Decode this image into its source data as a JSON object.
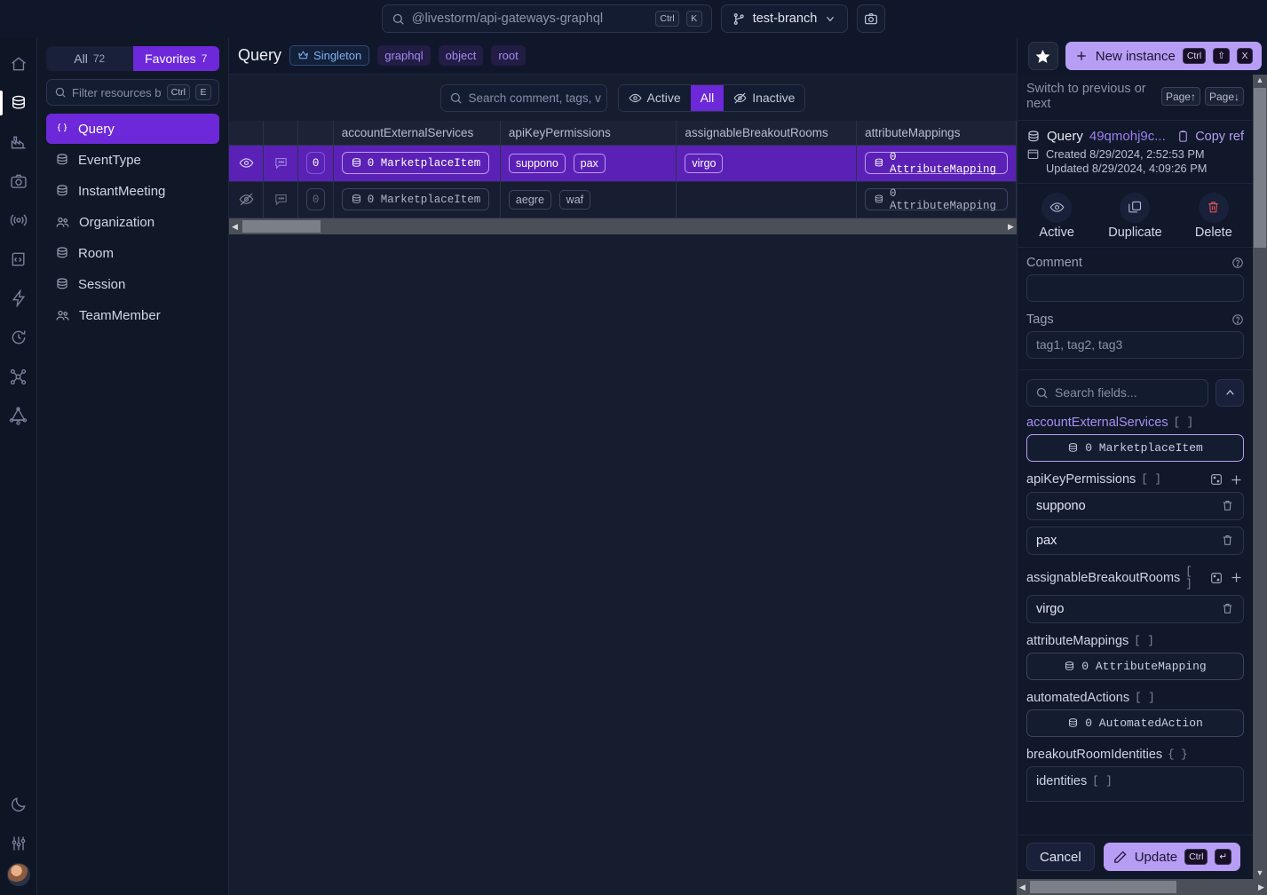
{
  "topbar": {
    "search_placeholder": "@livestorm/api-gateways-graphql",
    "search_kbd": [
      "Ctrl",
      "K"
    ],
    "branch": "test-branch",
    "camera_icon": "camera-icon"
  },
  "rail": {
    "items": [
      {
        "name": "home",
        "icon": "home-icon"
      },
      {
        "name": "database",
        "icon": "database-icon",
        "active": true
      },
      {
        "name": "factory",
        "icon": "factory-icon"
      },
      {
        "name": "camera",
        "icon": "camera-icon"
      },
      {
        "name": "broadcast",
        "icon": "broadcast-icon"
      },
      {
        "name": "code",
        "icon": "code-icon"
      },
      {
        "name": "lightning",
        "icon": "lightning-icon"
      },
      {
        "name": "history",
        "icon": "history-icon"
      },
      {
        "name": "graph",
        "icon": "graph-icon"
      },
      {
        "name": "graphql",
        "icon": "graphql-icon"
      }
    ],
    "bottom": [
      {
        "name": "theme",
        "icon": "moon-icon"
      },
      {
        "name": "settings",
        "icon": "sliders-icon"
      }
    ]
  },
  "resources": {
    "tab_all": "All",
    "tab_all_count": "72",
    "tab_fav": "Favorites",
    "tab_fav_count": "7",
    "filter_placeholder": "Filter resources by",
    "filter_kbd": [
      "Ctrl",
      "E"
    ],
    "items": [
      {
        "label": "Query",
        "icon": "braces-icon",
        "selected": true
      },
      {
        "label": "EventType",
        "icon": "database-icon",
        "selected": false
      },
      {
        "label": "InstantMeeting",
        "icon": "database-icon",
        "selected": false
      },
      {
        "label": "Organization",
        "icon": "people-icon",
        "selected": false
      },
      {
        "label": "Room",
        "icon": "database-icon",
        "selected": false
      },
      {
        "label": "Session",
        "icon": "database-icon",
        "selected": false
      },
      {
        "label": "TeamMember",
        "icon": "people-icon",
        "selected": false
      }
    ]
  },
  "center": {
    "title": "Query",
    "chips": [
      {
        "label": "Singleton",
        "icon": "crown-icon",
        "style": "singleton"
      },
      {
        "label": "graphql",
        "style": "purple"
      },
      {
        "label": "object",
        "style": "purple"
      },
      {
        "label": "root",
        "style": "purple"
      }
    ],
    "search_placeholder": "Search comment, tags, v",
    "filters": [
      {
        "label": "Active",
        "icon": "eye-icon",
        "on": false
      },
      {
        "label": "All",
        "on": true
      },
      {
        "label": "Inactive",
        "icon": "eye-off-icon",
        "on": false
      }
    ],
    "table": {
      "columns": [
        "accountExternalServices",
        "apiKeyPermissions",
        "assignableBreakoutRooms",
        "attributeMappings"
      ],
      "rows": [
        {
          "selected": true,
          "visibility_icon": "eye-icon",
          "comment_icon": "comment-icon",
          "attachment_count": "0",
          "accountExternalServices": "0 MarketplaceItem",
          "apiKeyPermissions": [
            "suppono",
            "pax"
          ],
          "assignableBreakoutRooms": [
            "virgo"
          ],
          "attributeMappings": "0 AttributeMapping"
        },
        {
          "selected": false,
          "visibility_icon": "eye-off-icon",
          "comment_icon": "comment-icon",
          "attachment_count": "0",
          "accountExternalServices": "0 MarketplaceItem",
          "apiKeyPermissions": [
            "aegre",
            "waf"
          ],
          "assignableBreakoutRooms": [],
          "attributeMappings": "0 AttributeMapping"
        }
      ]
    }
  },
  "right": {
    "star_icon": "star-icon",
    "new_instance_label": "New instance",
    "new_instance_kbd": [
      "Ctrl",
      "⇧",
      "X"
    ],
    "switch_label": "Switch to previous or next",
    "switch_kbd": [
      "Page↑",
      "Page↓"
    ],
    "entity_name": "Query",
    "entity_id": "49qmohj9c...",
    "copy_ref": "Copy ref",
    "created": "Created 8/29/2024, 2:52:53 PM",
    "updated": "Updated 8/29/2024, 4:09:26 PM",
    "actions": [
      {
        "label": "Active",
        "icon": "eye-icon",
        "danger": false
      },
      {
        "label": "Duplicate",
        "icon": "duplicate-icon",
        "danger": false
      },
      {
        "label": "Delete",
        "icon": "trash-icon",
        "danger": true
      }
    ],
    "comment_label": "Comment",
    "comment_value": "",
    "tags_label": "Tags",
    "tags_placeholder": "tag1, tag2, tag3",
    "fields_search_placeholder": "Search fields...",
    "fields": [
      {
        "name": "accountExternalServices",
        "type": "[ ]",
        "accent": true,
        "kind": "relation",
        "relation_label": "0 MarketplaceItem",
        "highlight": true
      },
      {
        "name": "apiKeyPermissions",
        "type": "[ ]",
        "accent": false,
        "kind": "list",
        "has_dice": true,
        "has_plus": true,
        "values": [
          "suppono",
          "pax"
        ]
      },
      {
        "name": "assignableBreakoutRooms",
        "type": "[ ]",
        "accent": false,
        "kind": "list",
        "has_dice": true,
        "has_plus": true,
        "values": [
          "virgo"
        ]
      },
      {
        "name": "attributeMappings",
        "type": "[ ]",
        "accent": false,
        "kind": "relation",
        "relation_label": "0 AttributeMapping",
        "highlight": false
      },
      {
        "name": "automatedActions",
        "type": "[ ]",
        "accent": false,
        "kind": "relation",
        "relation_label": "0 AutomatedAction",
        "highlight": false
      },
      {
        "name": "breakoutRoomIdentities",
        "type": "{ }",
        "accent": false,
        "kind": "object",
        "child_name": "identities",
        "child_type": "[ ]"
      }
    ],
    "cancel_label": "Cancel",
    "update_label": "Update",
    "update_kbd": [
      "Ctrl",
      "↵"
    ]
  },
  "colors": {
    "accent_purple": "#6d28d9",
    "accent_light": "#b79df4",
    "row_selected": "#5b21b6",
    "bg_dark": "#10172a",
    "danger": "#e05555"
  }
}
